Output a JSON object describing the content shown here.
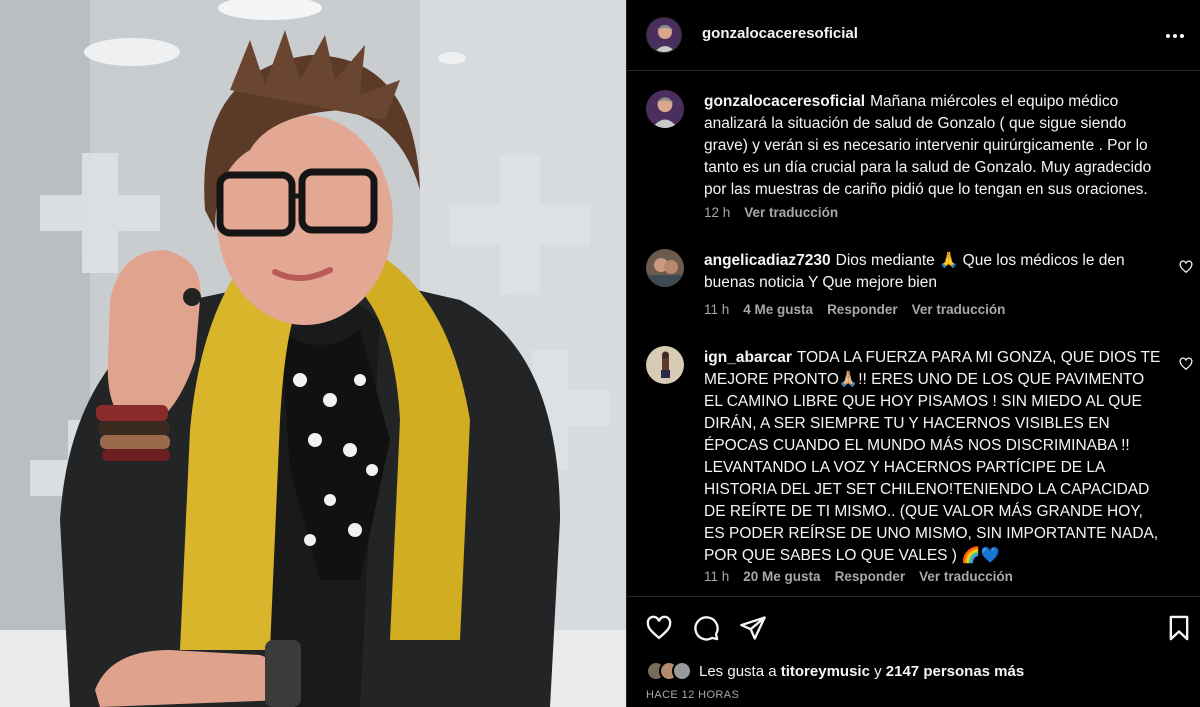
{
  "header": {
    "username": "gonzalocaceresoficial",
    "more_icon": "more-horizontal-icon"
  },
  "caption": {
    "username": "gonzalocaceresoficial",
    "text": "Mañana miércoles el equipo médico analizará la situación de salud de Gonzalo ( que sigue siendo grave) y verán si es necesario intervenir quirúrgicamente . Por lo tanto es un día crucial para la salud de Gonzalo. Muy agradecido por las muestras de cariño pidió que lo tengan en sus oraciones.",
    "time": "12 h",
    "translate": "Ver traducción"
  },
  "comments": [
    {
      "username": "angelicadiaz7230",
      "text": "Dios mediante 🙏  Que los médicos le den buenas noticia Y Que mejore bien",
      "time": "11 h",
      "likes": "4 Me gusta",
      "reply": "Responder",
      "translate": "Ver traducción"
    },
    {
      "username": "ign_abarcar",
      "text": "TODA LA FUERZA PARA MI GONZA, QUE DIOS TE MEJORE PRONTO🙏🏼!! ERES UNO DE LOS QUE PAVIMENTO EL CAMINO LIBRE QUE HOY PISAMOS ! SIN MIEDO AL QUE DIRÁN, A SER SIEMPRE TU Y HACERNOS VISIBLES EN ÉPOCAS CUANDO EL MUNDO MÁS NOS DISCRIMINABA !! LEVANTANDO LA VOZ Y HACERNOS PARTÍCIPE DE LA HISTORIA DEL JET SET CHILENO!TENIENDO LA CAPACIDAD DE REÍRTE DE TI MISMO.. (QUE VALOR MÁS GRANDE HOY, ES PODER REÍRSE DE UNO MISMO, SIN IMPORTANTE NADA, POR QUE SABES LO QUE VALES ) 🌈💙",
      "time": "11 h",
      "likes": "20 Me gusta",
      "reply": "Responder",
      "translate": "Ver traducción"
    }
  ],
  "actions": {
    "like_icon": "heart-icon",
    "comment_icon": "comment-icon",
    "share_icon": "share-icon",
    "save_icon": "bookmark-icon"
  },
  "likes": {
    "prefix": "Les gusta a",
    "user": "titoreymusic",
    "middle": "y",
    "others": "2147 personas más"
  },
  "posted": "HACE 12 HORAS",
  "colors": {
    "background": "#000000",
    "text": "#f5f5f5",
    "secondary": "#a8a8a8",
    "divider": "#262626"
  }
}
